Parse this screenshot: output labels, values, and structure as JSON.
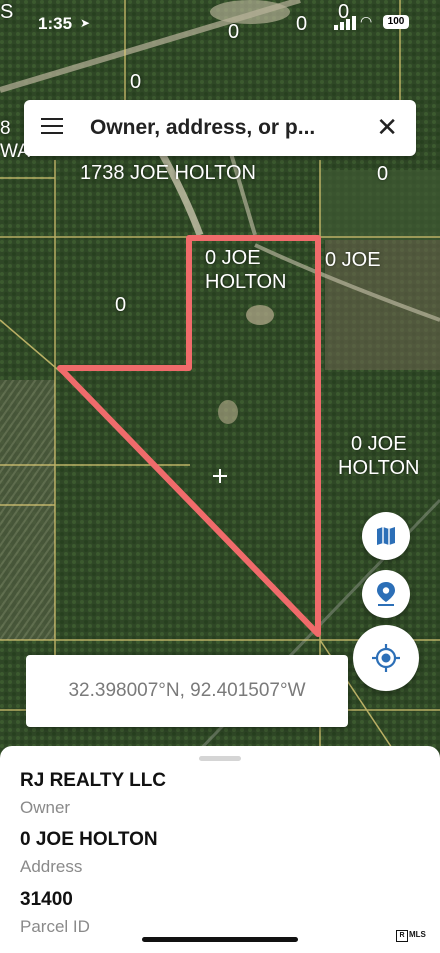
{
  "status_bar": {
    "time": "1:35",
    "battery": "100"
  },
  "map_labels": {
    "label_0_top_a": "0",
    "label_0_top_b": "0",
    "label_0_top_c": "0",
    "label_0_left": "0",
    "label_frag_top": "S",
    "label_frag_mid": "8\nWA",
    "label_1738": "1738 JOE HOLTON",
    "label_0_right": "0",
    "label_subject": "0 JOE\nHOLTON",
    "label_0_joe": "0 JOE",
    "label_0_inner": "0",
    "label_east": "0 JOE\nHOLTON"
  },
  "search": {
    "query": "Owner, address, or p..."
  },
  "icons": {
    "menu": "menu-icon",
    "close": "close-icon",
    "layers": "map-layers-icon",
    "pin": "location-pin-icon",
    "locate": "my-location-icon",
    "center": "crosshair-icon"
  },
  "coordinates": "32.398007°N, 92.401507°W",
  "parcel": {
    "owner": "RJ REALTY LLC",
    "owner_label": "Owner",
    "address": "0 JOE HOLTON",
    "address_label": "Address",
    "parcel_id": "31400",
    "parcel_id_label": "Parcel ID"
  },
  "watermark": "MLS",
  "colors": {
    "boundary": "#f06b6b",
    "accent": "#2c6fb7",
    "parcel_lines": "#e8d27a"
  }
}
